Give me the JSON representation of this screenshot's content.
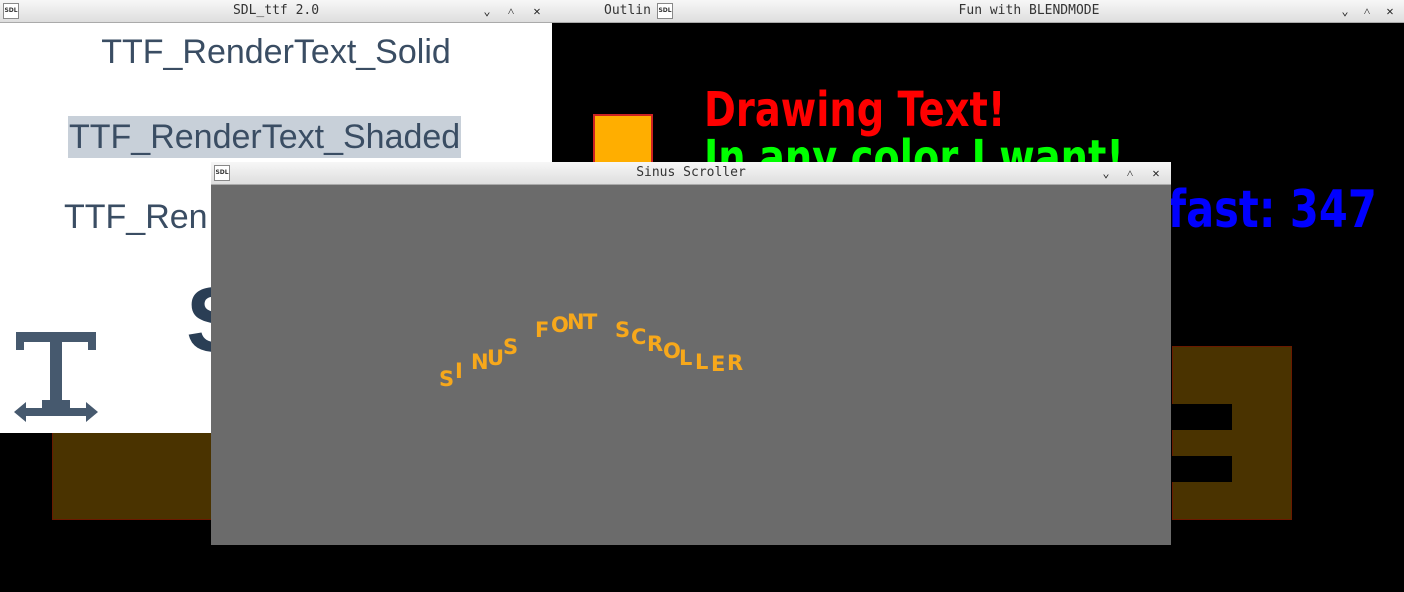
{
  "windows": {
    "sdl_ttf": {
      "title": "SDL_ttf 2.0",
      "logo": "SDL",
      "lines": [
        "TTF_RenderText_Solid",
        "TTF_RenderText_Shaded",
        "TTF_Ren"
      ],
      "big_letter": "S",
      "icon_glyph": "T"
    },
    "outline": {
      "title": "Outlin"
    },
    "blend": {
      "title": "Fun with BLENDMODE",
      "logo": "SDL",
      "text1": "Drawing Text!",
      "text2": "In any color I want!",
      "text3": "fast: 347",
      "colors": {
        "text1": "#ff0000",
        "text2": "#00ff00",
        "text3": "#0000ff",
        "square": "#ffae00"
      }
    },
    "sinus": {
      "title": "Sinus Scroller",
      "logo": "SDL",
      "scroll_text": "SINUS FONT SCROLLER",
      "scroll_color": "#f7a81b"
    }
  },
  "buttons": {
    "minimize": "⌄",
    "maximize": "˄",
    "close": "✕"
  }
}
